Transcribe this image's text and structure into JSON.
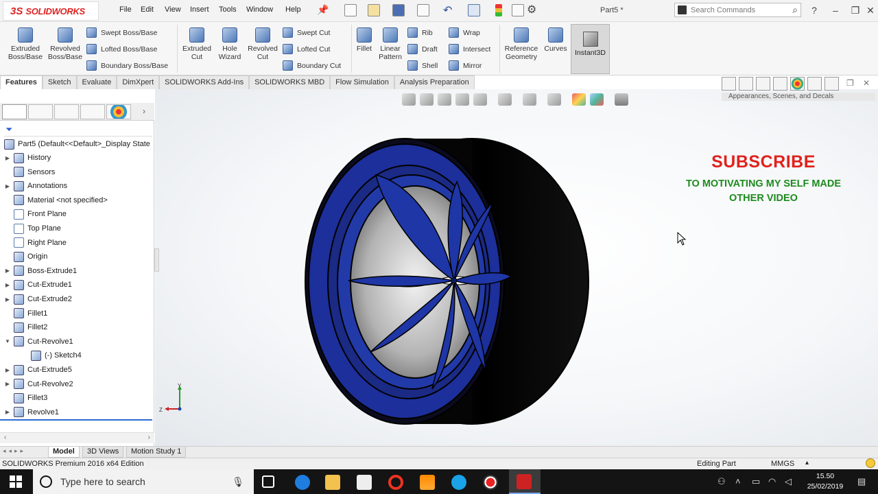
{
  "app": {
    "name": "SOLIDWORKS",
    "doc_title": "Part5 *"
  },
  "menu": [
    "File",
    "Edit",
    "View",
    "Insert",
    "Tools",
    "Window",
    "Help"
  ],
  "search": {
    "placeholder": "Search Commands"
  },
  "command_manager": {
    "big_buttons": [
      {
        "label": "Extruded\nBoss/Base",
        "icon": "extruded-boss-icon"
      },
      {
        "label": "Revolved\nBoss/Base",
        "icon": "revolved-boss-icon"
      },
      {
        "label": "Extruded\nCut",
        "icon": "extruded-cut-icon"
      },
      {
        "label": "Hole\nWizard",
        "icon": "hole-wizard-icon"
      },
      {
        "label": "Revolved\nCut",
        "icon": "revolved-cut-icon"
      },
      {
        "label": "Fillet",
        "icon": "fillet-icon"
      },
      {
        "label": "Linear\nPattern",
        "icon": "linear-pattern-icon"
      },
      {
        "label": "Reference\nGeometry",
        "icon": "reference-geometry-icon"
      },
      {
        "label": "Curves",
        "icon": "curves-icon"
      }
    ],
    "small_buttons": {
      "swept_boss": "Swept Boss/Base",
      "lofted_boss": "Lofted Boss/Base",
      "boundary_boss": "Boundary Boss/Base",
      "swept_cut": "Swept Cut",
      "lofted_cut": "Lofted Cut",
      "boundary_cut": "Boundary Cut",
      "rib": "Rib",
      "draft": "Draft",
      "shell": "Shell",
      "wrap": "Wrap",
      "intersect": "Intersect",
      "mirror": "Mirror"
    },
    "instant3d": "Instant3D"
  },
  "tabs": [
    "Features",
    "Sketch",
    "Evaluate",
    "DimXpert",
    "SOLIDWORKS Add-Ins",
    "SOLIDWORKS MBD",
    "Flow Simulation",
    "Analysis Preparation"
  ],
  "task_pane": {
    "title": "Appearances, Scenes, and Decals"
  },
  "feature_tree": {
    "root": "Part5  (Default<<Default>_Display State",
    "items": [
      {
        "label": "History",
        "expandable": true
      },
      {
        "label": "Sensors",
        "expandable": false
      },
      {
        "label": "Annotations",
        "expandable": true
      },
      {
        "label": "Material <not specified>",
        "expandable": false
      },
      {
        "label": "Front Plane",
        "expandable": false
      },
      {
        "label": "Top Plane",
        "expandable": false
      },
      {
        "label": "Right Plane",
        "expandable": false
      },
      {
        "label": "Origin",
        "expandable": false
      },
      {
        "label": "Boss-Extrude1",
        "expandable": true
      },
      {
        "label": "Cut-Extrude1",
        "expandable": true
      },
      {
        "label": "Cut-Extrude2",
        "expandable": true
      },
      {
        "label": "Fillet1",
        "expandable": false
      },
      {
        "label": "Fillet2",
        "expandable": false
      },
      {
        "label": "Cut-Revolve1",
        "expandable": true,
        "expanded": true
      },
      {
        "label": "(-) Sketch4",
        "expandable": false,
        "child": true
      },
      {
        "label": "Cut-Extrude5",
        "expandable": true
      },
      {
        "label": "Cut-Revolve2",
        "expandable": true
      },
      {
        "label": "Fillet3",
        "expandable": false
      },
      {
        "label": "Revolve1",
        "expandable": true
      }
    ]
  },
  "overlay": {
    "subscribe": "SUBSCRIBE",
    "line2": "TO MOTIVATING MY SELF MADE",
    "line3": "OTHER VIDEO"
  },
  "triad": {
    "y": "Y",
    "z": "Z"
  },
  "bottom_tabs": [
    "Model",
    "3D Views",
    "Motion Study 1"
  ],
  "status": {
    "edition": "SOLIDWORKS Premium 2016 x64 Edition",
    "mode": "Editing Part",
    "units": "MMGS"
  },
  "taskbar": {
    "search_placeholder": "Type here to search",
    "time": "15.50",
    "date": "25/02/2019"
  },
  "colors": {
    "rim": "#1c2f9a",
    "tire": "#050505",
    "subscribe": "#e0221c",
    "subtitle": "#1e8a1e",
    "brand": "#d22222"
  }
}
